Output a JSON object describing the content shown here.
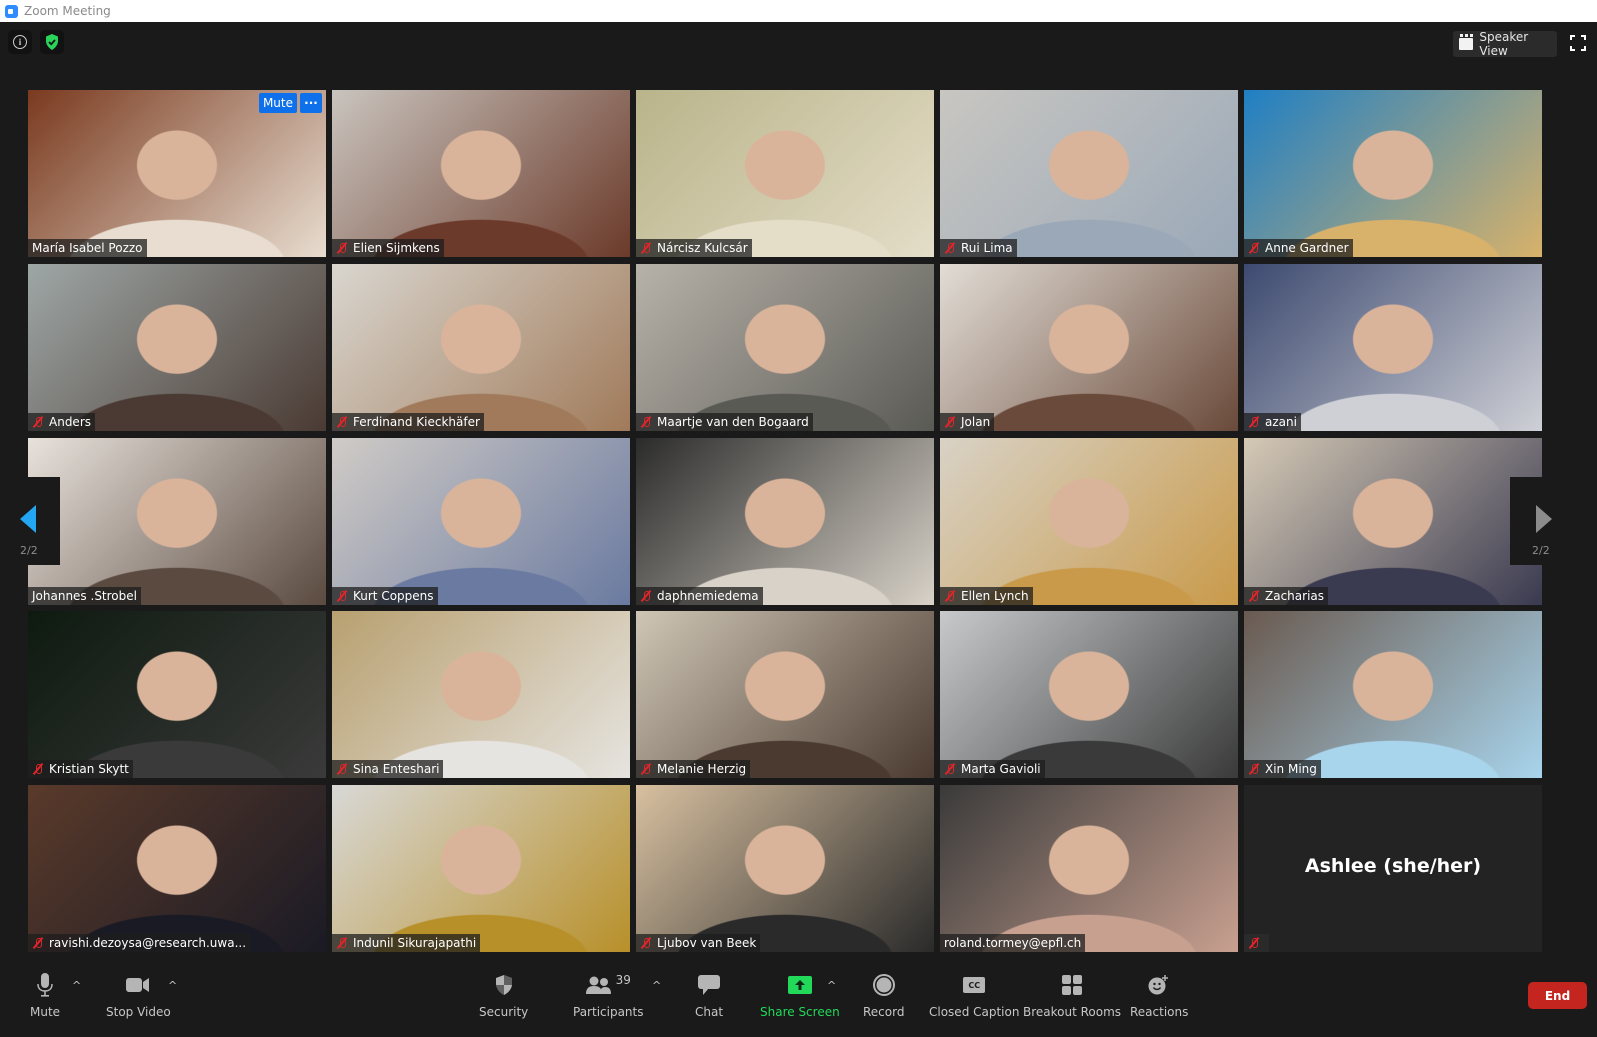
{
  "window": {
    "title": "Zoom Meeting"
  },
  "topbar": {
    "view_label": "Speaker View"
  },
  "navigation": {
    "page_left": "2/2",
    "page_right": "2/2"
  },
  "tile_actions": {
    "mute_label": "Mute",
    "more_label": "···"
  },
  "participants": [
    {
      "name": "María Isabel Pozzo",
      "muted": false,
      "bg": "#7a3a1f",
      "bg2": "#e8ddd0"
    },
    {
      "name": "Elien Sijmkens",
      "muted": true,
      "bg": "#c9c4be",
      "bg2": "#6b3a2a"
    },
    {
      "name": "Nárcisz Kulcsár",
      "muted": true,
      "bg": "#b9b48a",
      "bg2": "#e4ddc8"
    },
    {
      "name": "Rui Lima",
      "muted": true,
      "bg": "#c8c6c1",
      "bg2": "#9aa8b8"
    },
    {
      "name": "Anne Gardner",
      "muted": true,
      "bg": "#1f7fc4",
      "bg2": "#d8b26a"
    },
    {
      "name": "Anders",
      "muted": true,
      "bg": "#9ea7a6",
      "bg2": "#4a3a33"
    },
    {
      "name": "Ferdinand Kieckhäfer",
      "muted": true,
      "bg": "#d9d6cf",
      "bg2": "#a07a5a"
    },
    {
      "name": "Maartje van den Bogaard",
      "muted": true,
      "bg": "#b7b2a9",
      "bg2": "#5a5a55"
    },
    {
      "name": "Jolan",
      "muted": true,
      "bg": "#e2ddd6",
      "bg2": "#6a4a3a"
    },
    {
      "name": "azani",
      "muted": true,
      "bg": "#3d4a70",
      "bg2": "#cfd0d6"
    },
    {
      "name": "Johannes .Strobel",
      "muted": false,
      "bg": "#e8e2dc",
      "bg2": "#5a4a40"
    },
    {
      "name": "Kurt Coppens",
      "muted": true,
      "bg": "#d0cbc6",
      "bg2": "#6a7aa0"
    },
    {
      "name": "daphnemiedema",
      "muted": true,
      "bg": "#2b2b2b",
      "bg2": "#d8d2c8"
    },
    {
      "name": "Ellen Lynch",
      "muted": true,
      "bg": "#d8d2c6",
      "bg2": "#c99a4a"
    },
    {
      "name": "Zacharias",
      "muted": true,
      "bg": "#d5c9b5",
      "bg2": "#3a3a50"
    },
    {
      "name": "Kristian Skytt",
      "muted": true,
      "bg": "#0e1a10",
      "bg2": "#3a3a3a"
    },
    {
      "name": "Sina Enteshari",
      "muted": true,
      "bg": "#b8a070",
      "bg2": "#e6e4e0"
    },
    {
      "name": "Melanie Herzig",
      "muted": true,
      "bg": "#cfc6b5",
      "bg2": "#4a3a30"
    },
    {
      "name": "Marta Gavioli",
      "muted": true,
      "bg": "#c7c9cb",
      "bg2": "#3a3a3a"
    },
    {
      "name": "Xin Ming",
      "muted": true,
      "bg": "#6a5a50",
      "bg2": "#a8d4ec"
    },
    {
      "name": "ravishi.dezoysa@research.uwa...",
      "muted": true,
      "bg": "#5a3a2a",
      "bg2": "#1a1a25"
    },
    {
      "name": "Indunil Sikurajapathi",
      "muted": true,
      "bg": "#d8d8d6",
      "bg2": "#b8902a"
    },
    {
      "name": "Ljubov van Beek",
      "muted": true,
      "bg": "#d8c0a0",
      "bg2": "#2a2a2a"
    },
    {
      "name": "roland.tormey@epfl.ch",
      "muted": false,
      "bg": "#3a3a3a",
      "bg2": "#c8a090"
    },
    {
      "name": "Ashlee (she/her)",
      "muted": true,
      "video_off": true
    }
  ],
  "toolbar": {
    "mute": "Mute",
    "stop_video": "Stop Video",
    "security": "Security",
    "participants": "Participants",
    "participants_count": "39",
    "chat": "Chat",
    "share_screen": "Share Screen",
    "record": "Record",
    "closed_caption": "Closed Caption",
    "cc_glyph": "CC",
    "breakout_rooms": "Breakout Rooms",
    "reactions": "Reactions",
    "end": "End",
    "caret": "^"
  },
  "colors": {
    "accent_blue": "#0e71eb",
    "share_green": "#23d959",
    "end_red": "#c4261f",
    "muted_red": "#e0262a",
    "shield_green": "#2bd35a"
  }
}
